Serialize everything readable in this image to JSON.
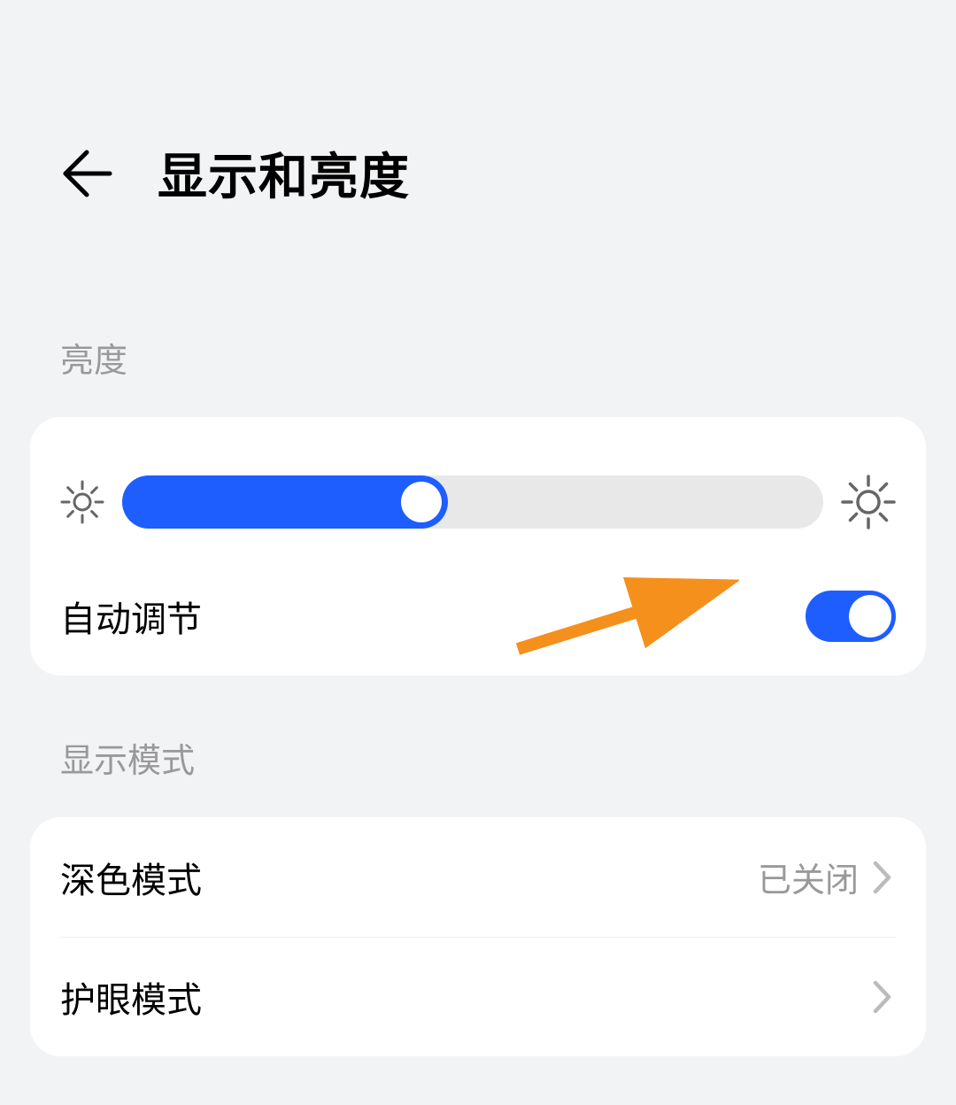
{
  "header": {
    "title": "显示和亮度"
  },
  "sections": {
    "brightness": {
      "label": "亮度",
      "slider_percent": 46,
      "auto_label": "自动调节",
      "auto_enabled": true
    },
    "display_mode": {
      "label": "显示模式",
      "items": [
        {
          "label": "深色模式",
          "value": "已关闭"
        },
        {
          "label": "护眼模式",
          "value": ""
        }
      ]
    }
  },
  "colors": {
    "accent": "#1e5eff",
    "annotation": "#f5901d"
  }
}
